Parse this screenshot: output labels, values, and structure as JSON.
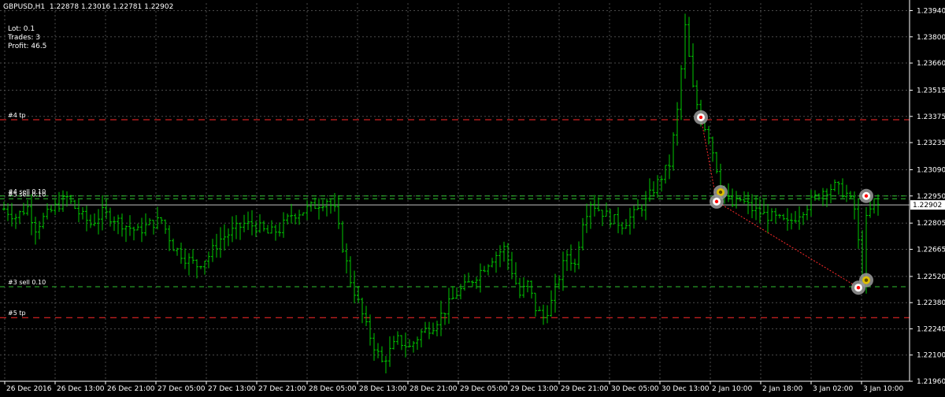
{
  "header": {
    "symbol_line": "GBPUSD,H1  1.22878 1.23016 1.22781 1.22902"
  },
  "info": {
    "lot": "Lot: 0.1",
    "trades": "Trades: 3",
    "profit": "Profit: 46.5"
  },
  "colors": {
    "background": "#000000",
    "candle": "#00c800",
    "grid": "#4a4a4a",
    "tp_line": "#ff2a2a",
    "order_line": "#2fbf2f",
    "bid_line": "#c0c0c0",
    "text": "#ffffff"
  },
  "chart_data": {
    "type": "ohlc",
    "symbol": "GBPUSD",
    "timeframe": "H1",
    "ylim": [
      1.2196,
      1.2398
    ],
    "y_ticks": [
      "1.23940",
      "1.23800",
      "1.23660",
      "1.23515",
      "1.23375",
      "1.23235",
      "1.23090",
      "1.22950",
      "1.22805",
      "1.22665",
      "1.22520",
      "1.22380",
      "1.22240",
      "1.22100",
      "1.21960"
    ],
    "x_ticks": [
      "26 Dec 2016",
      "26 Dec 13:00",
      "26 Dec 21:00",
      "27 Dec 05:00",
      "27 Dec 13:00",
      "27 Dec 21:00",
      "28 Dec 05:00",
      "28 Dec 13:00",
      "28 Dec 21:00",
      "29 Dec 05:00",
      "29 Dec 13:00",
      "29 Dec 21:00",
      "30 Dec 05:00",
      "30 Dec 13:00",
      "2 Jan 10:00",
      "2 Jan 18:00",
      "3 Jan 02:00",
      "3 Jan 10:00"
    ],
    "current_price": "1.22902",
    "hlines": [
      {
        "label": "#4 tp",
        "price": 1.23357,
        "kind": "tp"
      },
      {
        "label": "#4 sell 0.10",
        "price": 1.2295,
        "kind": "order"
      },
      {
        "label": "#5 tp",
        "price": 1.223,
        "kind": "tp"
      },
      {
        "label": "#3 sell 0.10",
        "price": 1.22465,
        "kind": "order"
      },
      {
        "label": "#5 sell 0.10",
        "price": 1.22935,
        "kind": "order"
      }
    ],
    "anchors": [
      {
        "x": 0,
        "y": 1.2288
      },
      {
        "x": 3,
        "y": 1.2284
      },
      {
        "x": 6,
        "y": 1.2289
      },
      {
        "x": 8,
        "y": 1.2278
      },
      {
        "x": 10,
        "y": 1.2283
      },
      {
        "x": 13,
        "y": 1.2289
      },
      {
        "x": 16,
        "y": 1.2294
      },
      {
        "x": 19,
        "y": 1.2286
      },
      {
        "x": 22,
        "y": 1.228
      },
      {
        "x": 25,
        "y": 1.2286
      },
      {
        "x": 28,
        "y": 1.2283
      },
      {
        "x": 31,
        "y": 1.2279
      },
      {
        "x": 34,
        "y": 1.2276
      },
      {
        "x": 37,
        "y": 1.228
      },
      {
        "x": 40,
        "y": 1.2282
      },
      {
        "x": 43,
        "y": 1.2268
      },
      {
        "x": 46,
        "y": 1.2262
      },
      {
        "x": 49,
        "y": 1.2258
      },
      {
        "x": 52,
        "y": 1.2263
      },
      {
        "x": 55,
        "y": 1.2272
      },
      {
        "x": 58,
        "y": 1.2276
      },
      {
        "x": 61,
        "y": 1.228
      },
      {
        "x": 64,
        "y": 1.2279
      },
      {
        "x": 67,
        "y": 1.2275
      },
      {
        "x": 70,
        "y": 1.2277
      },
      {
        "x": 73,
        "y": 1.2285
      },
      {
        "x": 76,
        "y": 1.2287
      },
      {
        "x": 79,
        "y": 1.229
      },
      {
        "x": 82,
        "y": 1.2293
      },
      {
        "x": 84,
        "y": 1.2287
      },
      {
        "x": 86,
        "y": 1.2268
      },
      {
        "x": 88,
        "y": 1.225
      },
      {
        "x": 90,
        "y": 1.2238
      },
      {
        "x": 92,
        "y": 1.2225
      },
      {
        "x": 94,
        "y": 1.2215
      },
      {
        "x": 96,
        "y": 1.2206
      },
      {
        "x": 98,
        "y": 1.2212
      },
      {
        "x": 100,
        "y": 1.2218
      },
      {
        "x": 103,
        "y": 1.2214
      },
      {
        "x": 106,
        "y": 1.2222
      },
      {
        "x": 109,
        "y": 1.2226
      },
      {
        "x": 112,
        "y": 1.2234
      },
      {
        "x": 115,
        "y": 1.2243
      },
      {
        "x": 118,
        "y": 1.2248
      },
      {
        "x": 121,
        "y": 1.2255
      },
      {
        "x": 124,
        "y": 1.2262
      },
      {
        "x": 127,
        "y": 1.2267
      },
      {
        "x": 129,
        "y": 1.2255
      },
      {
        "x": 131,
        "y": 1.2242
      },
      {
        "x": 133,
        "y": 1.2248
      },
      {
        "x": 135,
        "y": 1.2235
      },
      {
        "x": 137,
        "y": 1.223
      },
      {
        "x": 139,
        "y": 1.2238
      },
      {
        "x": 141,
        "y": 1.2252
      },
      {
        "x": 143,
        "y": 1.2264
      },
      {
        "x": 145,
        "y": 1.2258
      },
      {
        "x": 147,
        "y": 1.2282
      },
      {
        "x": 149,
        "y": 1.2292
      },
      {
        "x": 151,
        "y": 1.2288
      },
      {
        "x": 154,
        "y": 1.2283
      },
      {
        "x": 157,
        "y": 1.228
      },
      {
        "x": 160,
        "y": 1.2285
      },
      {
        "x": 163,
        "y": 1.2292
      },
      {
        "x": 166,
        "y": 1.2302
      },
      {
        "x": 169,
        "y": 1.2312
      },
      {
        "x": 171,
        "y": 1.234
      },
      {
        "x": 173,
        "y": 1.2385
      },
      {
        "x": 175,
        "y": 1.2352
      },
      {
        "x": 177,
        "y": 1.2336
      },
      {
        "x": 179,
        "y": 1.2328
      },
      {
        "x": 181,
        "y": 1.231
      },
      {
        "x": 183,
        "y": 1.2295
      },
      {
        "x": 185,
        "y": 1.229
      },
      {
        "x": 187,
        "y": 1.2293
      },
      {
        "x": 190,
        "y": 1.2288
      },
      {
        "x": 193,
        "y": 1.2285
      },
      {
        "x": 196,
        "y": 1.2283
      },
      {
        "x": 199,
        "y": 1.228
      },
      {
        "x": 202,
        "y": 1.2286
      },
      {
        "x": 205,
        "y": 1.2292
      },
      {
        "x": 208,
        "y": 1.2298
      },
      {
        "x": 211,
        "y": 1.23
      },
      {
        "x": 214,
        "y": 1.2296
      },
      {
        "x": 216,
        "y": 1.2288
      },
      {
        "x": 218,
        "y": 1.2252
      },
      {
        "x": 219,
        "y": 1.2282
      },
      {
        "x": 221,
        "y": 1.2292
      },
      {
        "x": 222,
        "y": 1.229
      }
    ],
    "markers": [
      {
        "x": 177,
        "y": 1.2337,
        "kind": "sell-entry"
      },
      {
        "x": 182,
        "y": 1.2297,
        "kind": "close"
      },
      {
        "x": 181,
        "y": 1.2292,
        "kind": "sell-entry"
      },
      {
        "x": 219,
        "y": 1.2295,
        "kind": "sell-entry"
      },
      {
        "x": 219,
        "y": 1.225,
        "kind": "close"
      },
      {
        "x": 217,
        "y": 1.2246,
        "kind": "sell-entry"
      }
    ],
    "trade_links": [
      {
        "from": 0,
        "to": 2
      },
      {
        "from": 2,
        "to": 5
      }
    ]
  }
}
